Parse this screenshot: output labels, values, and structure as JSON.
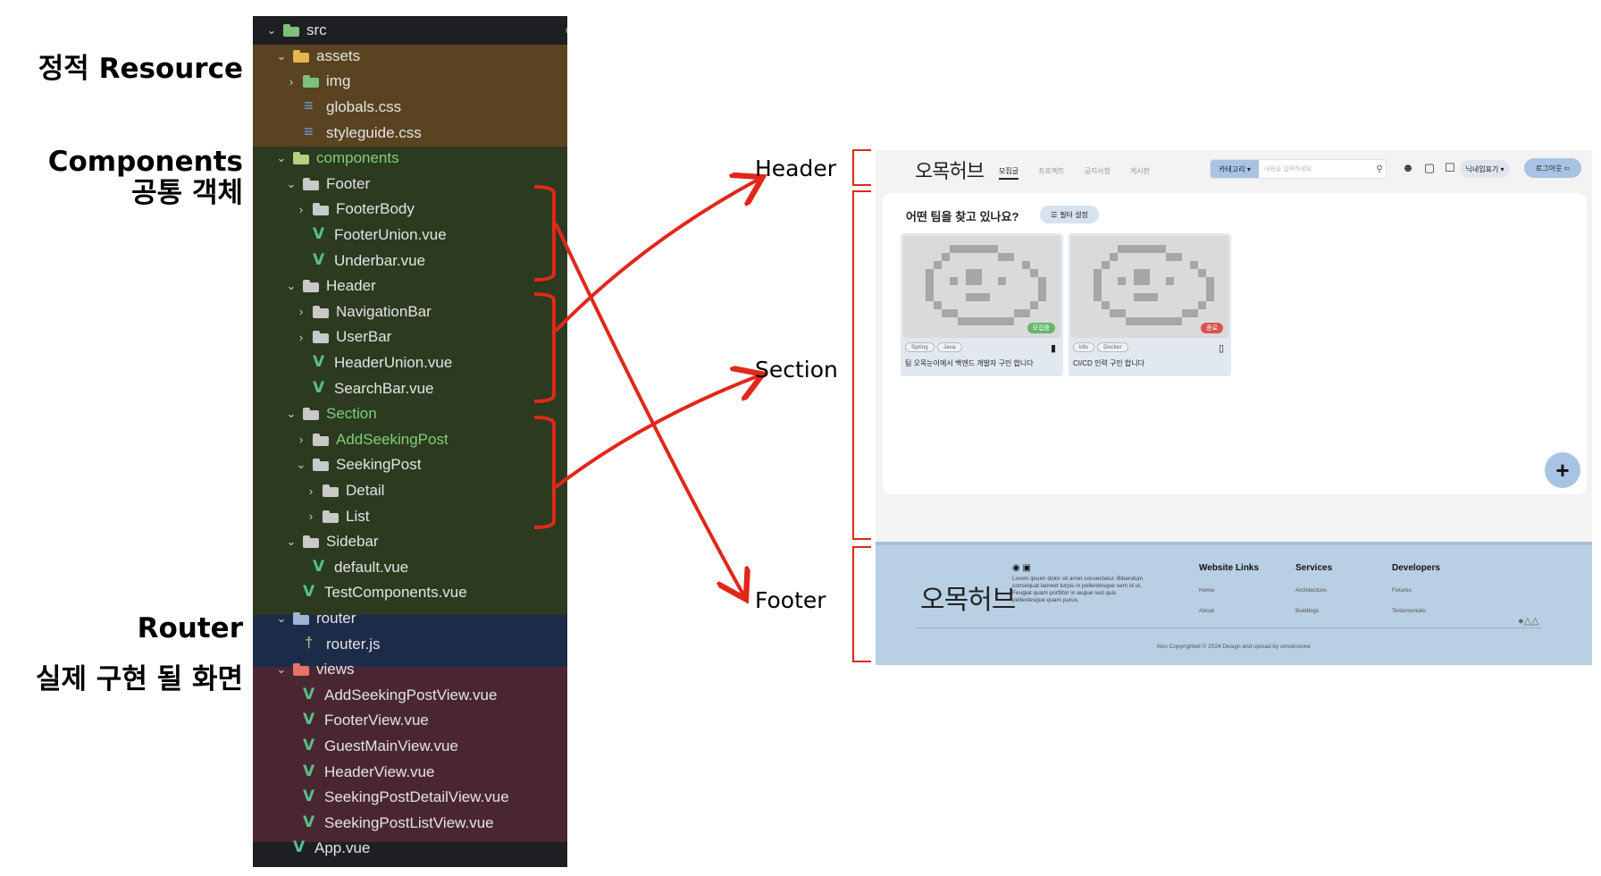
{
  "labels": {
    "static": "정적 Resource",
    "components_line1": "Components",
    "components_line2": "공통 객체",
    "router": "Router",
    "views": "실제 구현 될 화면",
    "header": "Header",
    "section": "Section",
    "footer": "Footer"
  },
  "tree": [
    {
      "depth": 0,
      "expanded": true,
      "icon": "folder-src-icon",
      "name": "src",
      "dot": true
    },
    {
      "depth": 1,
      "expanded": true,
      "icon": "folder-assets-icon",
      "name": "assets"
    },
    {
      "depth": 2,
      "expanded": false,
      "icon": "folder-img-icon",
      "name": "img"
    },
    {
      "depth": 2,
      "icon": "css-file-icon",
      "name": "globals.css"
    },
    {
      "depth": 2,
      "icon": "css-file-icon",
      "name": "styleguide.css"
    },
    {
      "depth": 1,
      "expanded": true,
      "icon": "folder-components-icon",
      "name": "components",
      "green": true,
      "dot": true
    },
    {
      "depth": 2,
      "expanded": true,
      "icon": "folder-icon",
      "name": "Footer"
    },
    {
      "depth": 3,
      "expanded": false,
      "icon": "folder-icon",
      "name": "FooterBody"
    },
    {
      "depth": 3,
      "icon": "vue-file-icon",
      "name": "FooterUnion.vue"
    },
    {
      "depth": 3,
      "icon": "vue-file-icon",
      "name": "Underbar.vue"
    },
    {
      "depth": 2,
      "expanded": true,
      "icon": "folder-icon",
      "name": "Header"
    },
    {
      "depth": 3,
      "expanded": false,
      "icon": "folder-icon",
      "name": "NavigationBar"
    },
    {
      "depth": 3,
      "expanded": false,
      "icon": "folder-icon",
      "name": "UserBar"
    },
    {
      "depth": 3,
      "icon": "vue-file-icon",
      "name": "HeaderUnion.vue"
    },
    {
      "depth": 3,
      "icon": "vue-file-icon",
      "name": "SearchBar.vue"
    },
    {
      "depth": 2,
      "expanded": true,
      "icon": "folder-icon",
      "name": "Section",
      "green": true,
      "dot": true
    },
    {
      "depth": 3,
      "expanded": false,
      "icon": "folder-icon",
      "name": "AddSeekingPost",
      "green": true,
      "dot": true
    },
    {
      "depth": 3,
      "expanded": true,
      "icon": "folder-icon",
      "name": "SeekingPost"
    },
    {
      "depth": 4,
      "expanded": false,
      "icon": "folder-icon",
      "name": "Detail"
    },
    {
      "depth": 4,
      "expanded": false,
      "icon": "folder-icon",
      "name": "List"
    },
    {
      "depth": 2,
      "expanded": true,
      "icon": "folder-icon",
      "name": "Sidebar"
    },
    {
      "depth": 3,
      "icon": "vue-file-icon",
      "name": "default.vue"
    },
    {
      "depth": 2,
      "icon": "vue-file-icon",
      "name": "TestComponents.vue"
    },
    {
      "depth": 1,
      "expanded": true,
      "icon": "folder-router-icon",
      "name": "router"
    },
    {
      "depth": 2,
      "icon": "js-file-icon",
      "name": "router.js"
    },
    {
      "depth": 1,
      "expanded": true,
      "icon": "folder-views-icon",
      "name": "views"
    },
    {
      "depth": 2,
      "icon": "vue-file-icon",
      "name": "AddSeekingPostView.vue"
    },
    {
      "depth": 2,
      "icon": "vue-file-icon",
      "name": "FooterView.vue"
    },
    {
      "depth": 2,
      "icon": "vue-file-icon",
      "name": "GuestMainView.vue"
    },
    {
      "depth": 2,
      "icon": "vue-file-icon",
      "name": "HeaderView.vue"
    },
    {
      "depth": 2,
      "icon": "vue-file-icon",
      "name": "SeekingPostDetailView.vue"
    },
    {
      "depth": 2,
      "icon": "vue-file-icon",
      "name": "SeekingPostListView.vue"
    },
    {
      "depth": 1,
      "icon": "vue-file-icon",
      "name": "App.vue"
    }
  ],
  "colors": {
    "arrow": "#e0281a",
    "assets_band": "#5a4320",
    "components_band": "#2c3a20",
    "router_band": "#1c2b48",
    "views_band": "#4a2633",
    "accent_blue": "#a9c3e4",
    "footer_bg": "#b9cfe3"
  },
  "screenshot": {
    "header": {
      "logo": "오목허브",
      "nav": [
        "모집글",
        "프로젝트",
        "공지사항",
        "게시판"
      ],
      "search_category": "카테고리 ▾",
      "search_placeholder": "내용을 입력하세요",
      "nickname": "닉네임표기 ▾",
      "logout": "로그아웃"
    },
    "section": {
      "question": "어떤 팀을 찾고 있나요?",
      "filter": "필터 설정",
      "posts": [
        {
          "tags": [
            "Spring",
            "Java"
          ],
          "status": "모집중",
          "status_color": "#63b86a",
          "title": "팀 오목눈이에서 백엔드 개발자 구인 합니다",
          "bookmarked": true
        },
        {
          "tags": [
            "k8s",
            "Docker"
          ],
          "status": "종료",
          "status_color": "#d9534f",
          "title": "CI/CD 인력 구인 합니다",
          "bookmarked": false
        }
      ],
      "add": "+"
    },
    "footer": {
      "logo": "오목허브",
      "lorem": "Lorem ipsum dolor sit amet consectetur. Bibendum consequat laoreet turpis in pellentesque sem id ut. Feugiat quam porttitor in augue sed quis pellentesque quam purus.",
      "columns": [
        {
          "title": "Website Links",
          "links": [
            "Home",
            "About"
          ]
        },
        {
          "title": "Services",
          "links": [
            "Architecture",
            "Buildings"
          ]
        },
        {
          "title": "Developers",
          "links": [
            "Fetures",
            "Testomonials"
          ]
        }
      ],
      "copyright": "Non Copyrighted © 2024 Design and upload by omoknoone"
    }
  }
}
